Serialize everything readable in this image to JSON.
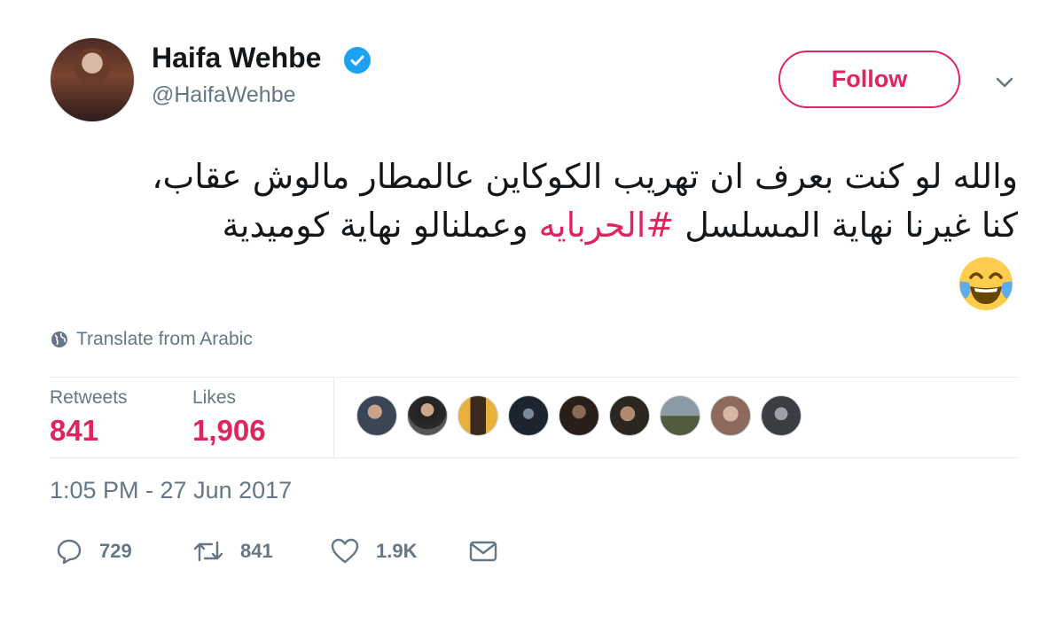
{
  "user": {
    "name": "Haifa Wehbe",
    "handle": "@HaifaWehbe",
    "verified": true,
    "follow_label": "Follow"
  },
  "tweet": {
    "line1": "والله لو كنت بعرف ان تهريب الكوكاين عالمطار مالوش عقاب،",
    "line2_start": "كنا غيرنا نهاية المسلسل ",
    "hashtag": "#الحربايه",
    "line2_end": "  وعملنالو نهاية كوميدية",
    "emoji": "face-with-tears-of-joy"
  },
  "translate_label": "Translate from Arabic",
  "stats": {
    "retweets_label": "Retweets",
    "retweets_value": "841",
    "likes_label": "Likes",
    "likes_value": "1,906"
  },
  "likers_count": 9,
  "timestamp": "1:05 PM - 27 Jun 2017",
  "actions": {
    "replies": "729",
    "retweets": "841",
    "likes": "1.9K"
  },
  "colors": {
    "accent": "#e0245e",
    "verified": "#1da1f2",
    "muted": "#657786"
  }
}
